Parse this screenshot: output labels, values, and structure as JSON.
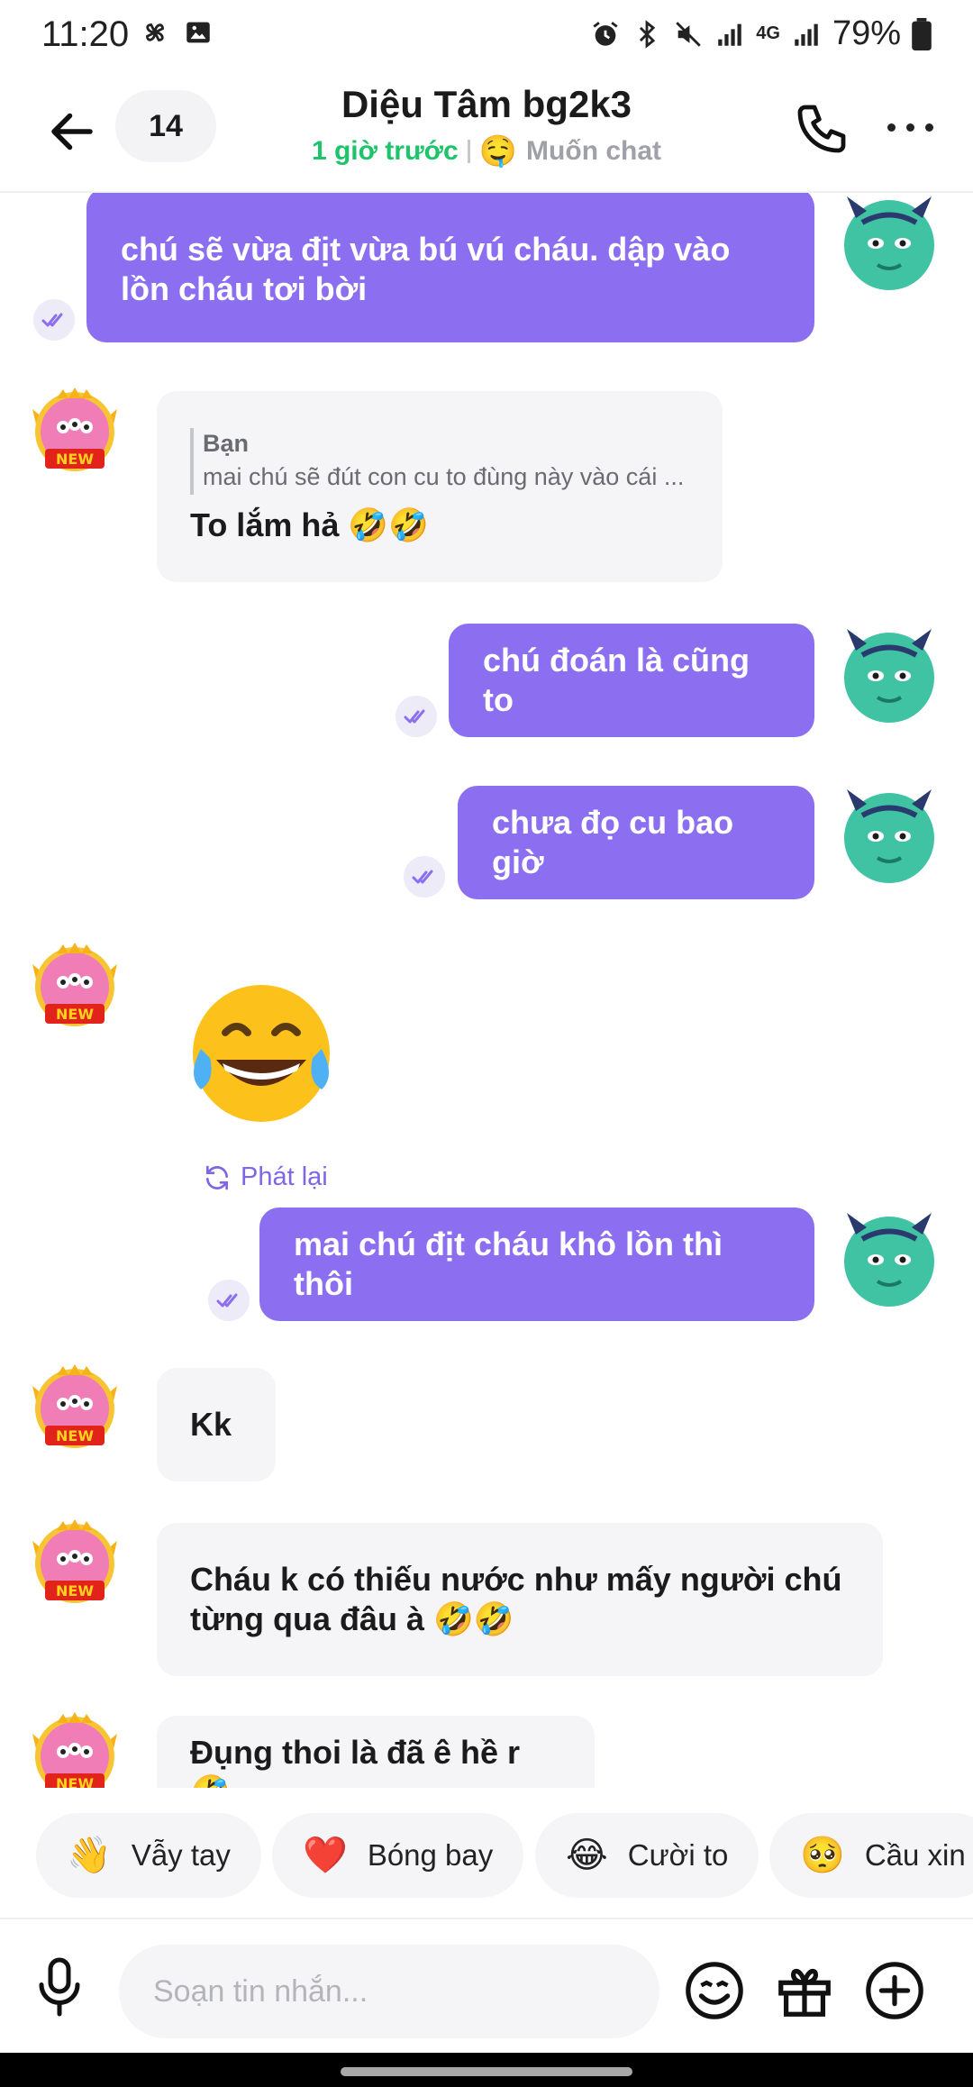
{
  "status_bar": {
    "time": "11:20",
    "battery": "79%",
    "network": "4G"
  },
  "header": {
    "unread_count": "14",
    "contact_name": "Diệu Tâm bg2k3",
    "last_seen": "1 giờ trước",
    "mood_emoji": "🤤",
    "mood_text": "Muốn chat"
  },
  "messages": [
    {
      "side": "out",
      "text": "chú sẽ vừa địt vừa bú vú cháu. dập vào lồn cháu tơi bời"
    },
    {
      "side": "in",
      "reply_to_name": "Bạn",
      "reply_to_text": "mai chú sẽ đút con cu to đùng này vào cái ...",
      "text": "To lắm hả 🤣🤣"
    },
    {
      "side": "out",
      "text": "chú đoán là cũng to"
    },
    {
      "side": "out",
      "text": "chưa đọ cu bao giờ"
    },
    {
      "side": "in",
      "emoji": "😂",
      "replay_label": "Phát lại"
    },
    {
      "side": "out",
      "text": "mai chú địt cháu khô lồn thì thôi"
    },
    {
      "side": "in",
      "text": "Kk"
    },
    {
      "side": "in",
      "text": "Cháu k có thiếu nước như mấy người chú từng qua đâu à 🤣🤣"
    },
    {
      "side": "in",
      "text": "Đụng thoi là đã ê hề r 🤣"
    }
  ],
  "quick_replies": [
    {
      "emoji": "👋",
      "label": "Vẫy tay"
    },
    {
      "emoji": "❤️",
      "label": "Bóng bay"
    },
    {
      "emoji": "😂",
      "label": "Cười to"
    },
    {
      "emoji": "🥺",
      "label": "Cầu xin"
    }
  ],
  "composer": {
    "placeholder": "Soạn tin nhắn..."
  },
  "colors": {
    "accent": "#8b6ff0",
    "online": "#1ec46a",
    "bubble_in": "#f5f5f8"
  },
  "icons": {
    "back": "arrow-left-icon",
    "call": "phone-icon",
    "more": "more-horizontal-icon",
    "seen": "double-check-icon",
    "replay": "refresh-icon",
    "mic": "microphone-icon",
    "emoji": "smile-icon",
    "gift": "gift-icon",
    "plus": "plus-circle-icon"
  }
}
